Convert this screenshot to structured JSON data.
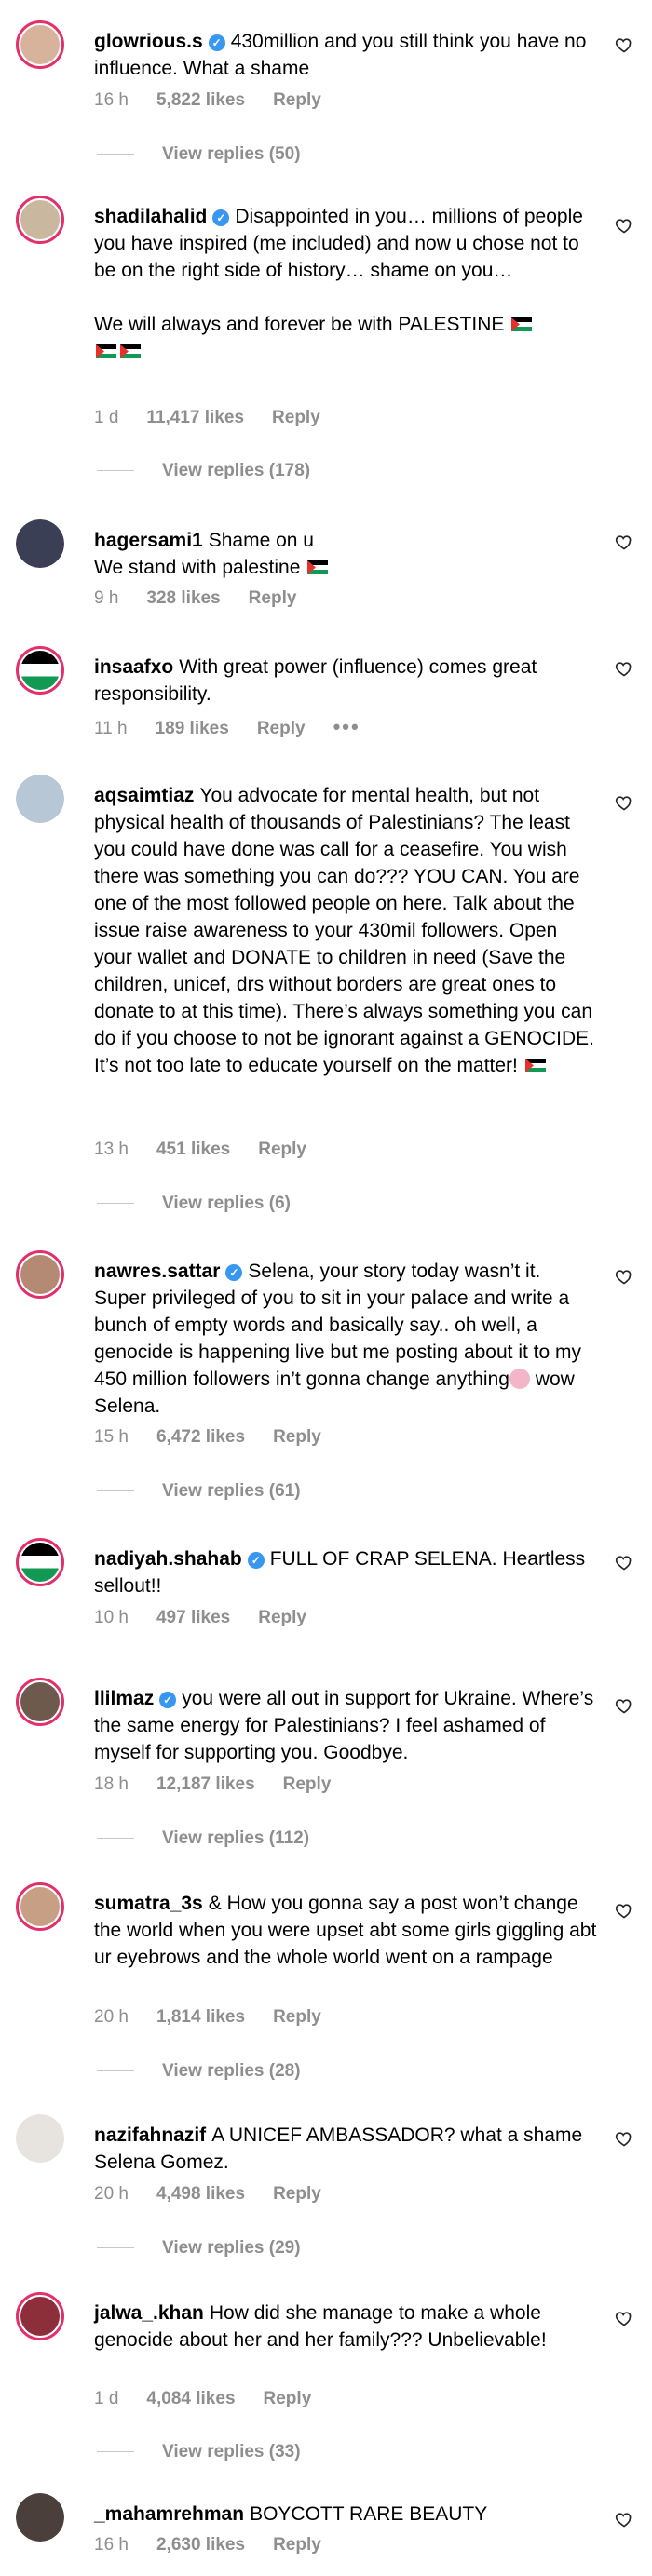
{
  "comments": [
    {
      "username": "glowrious.s",
      "verified": true,
      "text": "430million and you still think you have no influence. What a shame",
      "time": "16 h",
      "likes": "5,822 likes",
      "reply": "Reply",
      "view_replies": "View replies (50)"
    },
    {
      "username": "shadilahalid",
      "verified": true,
      "text": "Disappointed in you… millions of people you have inspired (me included) and now u chose not to be on the right side of history… shame on you…",
      "text2": "We will always and forever be with PALESTINE",
      "time": "1 d",
      "likes": "11,417 likes",
      "reply": "Reply",
      "view_replies": "View replies (178)"
    },
    {
      "username": "hagersami1",
      "verified": false,
      "text": "Shame on u",
      "text2": "We stand with palestine",
      "time": "9 h",
      "likes": "328 likes",
      "reply": "Reply"
    },
    {
      "username": "insaafxo",
      "verified": false,
      "text": "With great power (influence) comes great responsibility.",
      "time": "11 h",
      "likes": "189 likes",
      "reply": "Reply",
      "more": "•••"
    },
    {
      "username": "aqsaimtiaz",
      "verified": false,
      "text": "You advocate for mental health, but not physical health of thousands of Palestinians? The least you could have done was call for a ceasefire. You wish there was something you can do??? YOU CAN. You are one of the most followed people on here. Talk about the issue raise awareness to your 430mil followers. Open your wallet and DONATE to children in need (Save the children, unicef, drs without borders are great ones to donate to at this time). There’s always something you can do if you choose to not be ignorant against a GENOCIDE. It’s not too late to educate yourself on the matter!",
      "time": "13 h",
      "likes": "451 likes",
      "reply": "Reply",
      "view_replies": "View replies (6)"
    },
    {
      "username": "nawres.sattar",
      "verified": true,
      "text": "Selena, your story today wasn’t it. Super privileged of you to sit in your palace and write a bunch of empty words and basically say.. oh well, a genocide is happening live but me posting about it to my 450 million followers in’t gonna change anything",
      "text2": "wow Selena.",
      "time": "15 h",
      "likes": "6,472 likes",
      "reply": "Reply",
      "view_replies": "View replies (61)"
    },
    {
      "username": "nadiyah.shahab",
      "verified": true,
      "text": "FULL OF CRAP SELENA. Heartless sellout!!",
      "time": "10 h",
      "likes": "497 likes",
      "reply": "Reply"
    },
    {
      "username": "llilmaz",
      "verified": true,
      "text": "you were all out in support for Ukraine. Where’s the same energy for Palestinians? I feel ashamed of myself for supporting you. Goodbye.",
      "time": "18 h",
      "likes": "12,187 likes",
      "reply": "Reply",
      "view_replies": "View replies (112)"
    },
    {
      "username": "sumatra_3s",
      "verified": false,
      "text": "& How you gonna say a post won’t change the world when you were upset abt some girls giggling abt ur eyebrows and the whole world went on a rampage",
      "time": "20 h",
      "likes": "1,814 likes",
      "reply": "Reply",
      "view_replies": "View replies (28)"
    },
    {
      "username": "nazifahnazif",
      "verified": false,
      "text": "A UNICEF AMBASSADOR? what a shame Selena Gomez.",
      "time": "20 h",
      "likes": "4,498 likes",
      "reply": "Reply",
      "view_replies": "View replies (29)"
    },
    {
      "username": "jalwa_.khan",
      "verified": false,
      "text": "How did she manage to make a whole genocide about her and her family??? Unbelievable!",
      "time": "1 d",
      "likes": "4,084 likes",
      "reply": "Reply",
      "view_replies": "View replies (33)"
    },
    {
      "username": "_mahamrehman",
      "verified": false,
      "text": "BOYCOTT RARE BEAUTY",
      "time": "16 h",
      "likes": "2,630 likes",
      "reply": "Reply"
    }
  ],
  "colors": {
    "verified": "#3897f0",
    "muted": "#8e8e8e",
    "story_ring": "#e1306c"
  },
  "icons": {
    "like": "heart-outline-icon",
    "verified": "verified-badge-icon",
    "flag": "palestine-flag-emoji"
  }
}
